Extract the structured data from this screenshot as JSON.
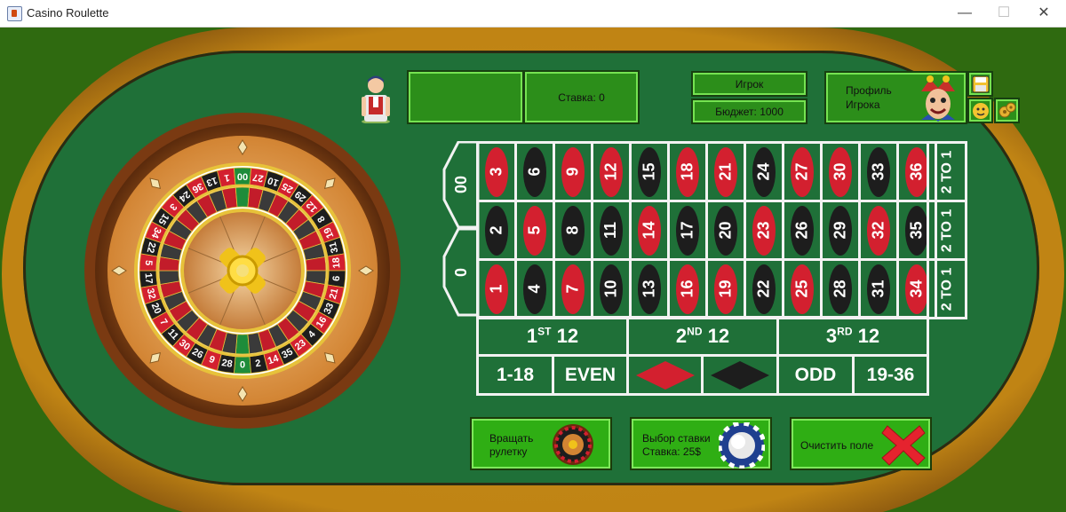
{
  "window": {
    "title": "Casino Roulette",
    "minimize": "—",
    "maximize": "☐",
    "close": "✕"
  },
  "status": {
    "bet_text": "Ставка: 0",
    "player_label": "Игрок",
    "budget_text": "Бюджет: 1000"
  },
  "profile": {
    "label_line1": "Профиль",
    "label_line2": "Игрока"
  },
  "wheel": {
    "numbers": [
      "0",
      "28",
      "9",
      "26",
      "30",
      "11",
      "7",
      "20",
      "32",
      "17",
      "5",
      "22",
      "34",
      "15",
      "3",
      "24",
      "36",
      "13",
      "1",
      "00",
      "27",
      "10",
      "25",
      "29",
      "12",
      "8",
      "19",
      "31",
      "18",
      "6",
      "21",
      "33",
      "16",
      "4",
      "23",
      "35",
      "14",
      "2"
    ]
  },
  "board": {
    "zero": "0",
    "double_zero": "00",
    "rows": [
      [
        "3",
        "6",
        "9",
        "12",
        "15",
        "18",
        "21",
        "24",
        "27",
        "30",
        "33",
        "36"
      ],
      [
        "2",
        "5",
        "8",
        "11",
        "14",
        "17",
        "20",
        "23",
        "26",
        "29",
        "32",
        "35"
      ],
      [
        "1",
        "4",
        "7",
        "10",
        "13",
        "16",
        "19",
        "22",
        "25",
        "28",
        "31",
        "34"
      ]
    ],
    "reds": [
      "1",
      "3",
      "5",
      "7",
      "9",
      "12",
      "14",
      "16",
      "18",
      "19",
      "21",
      "23",
      "25",
      "27",
      "30",
      "32",
      "34",
      "36"
    ],
    "column_bets": [
      "2 ТО 1",
      "2 ТО 1",
      "2 ТО 1"
    ],
    "dozens": [
      {
        "main": "1",
        "sup": "ST",
        "rest": " 12"
      },
      {
        "main": "2",
        "sup": "ND",
        "rest": " 12"
      },
      {
        "main": "3",
        "sup": "RD",
        "rest": " 12"
      }
    ],
    "outside": {
      "low": "1-18",
      "even": "EVEN",
      "odd": "ODD",
      "high": "19-36"
    }
  },
  "buttons": {
    "spin_line1": "Вращать",
    "spin_line2": "рулетку",
    "chip_line1": "Выбор ставки",
    "chip_line2": "Ставка: 25$",
    "clear_label": "Очистить поле"
  },
  "colors": {
    "red": "#d3202f",
    "black": "#1d1d1d",
    "felt": "#1f7038",
    "button": "#2fae14"
  }
}
